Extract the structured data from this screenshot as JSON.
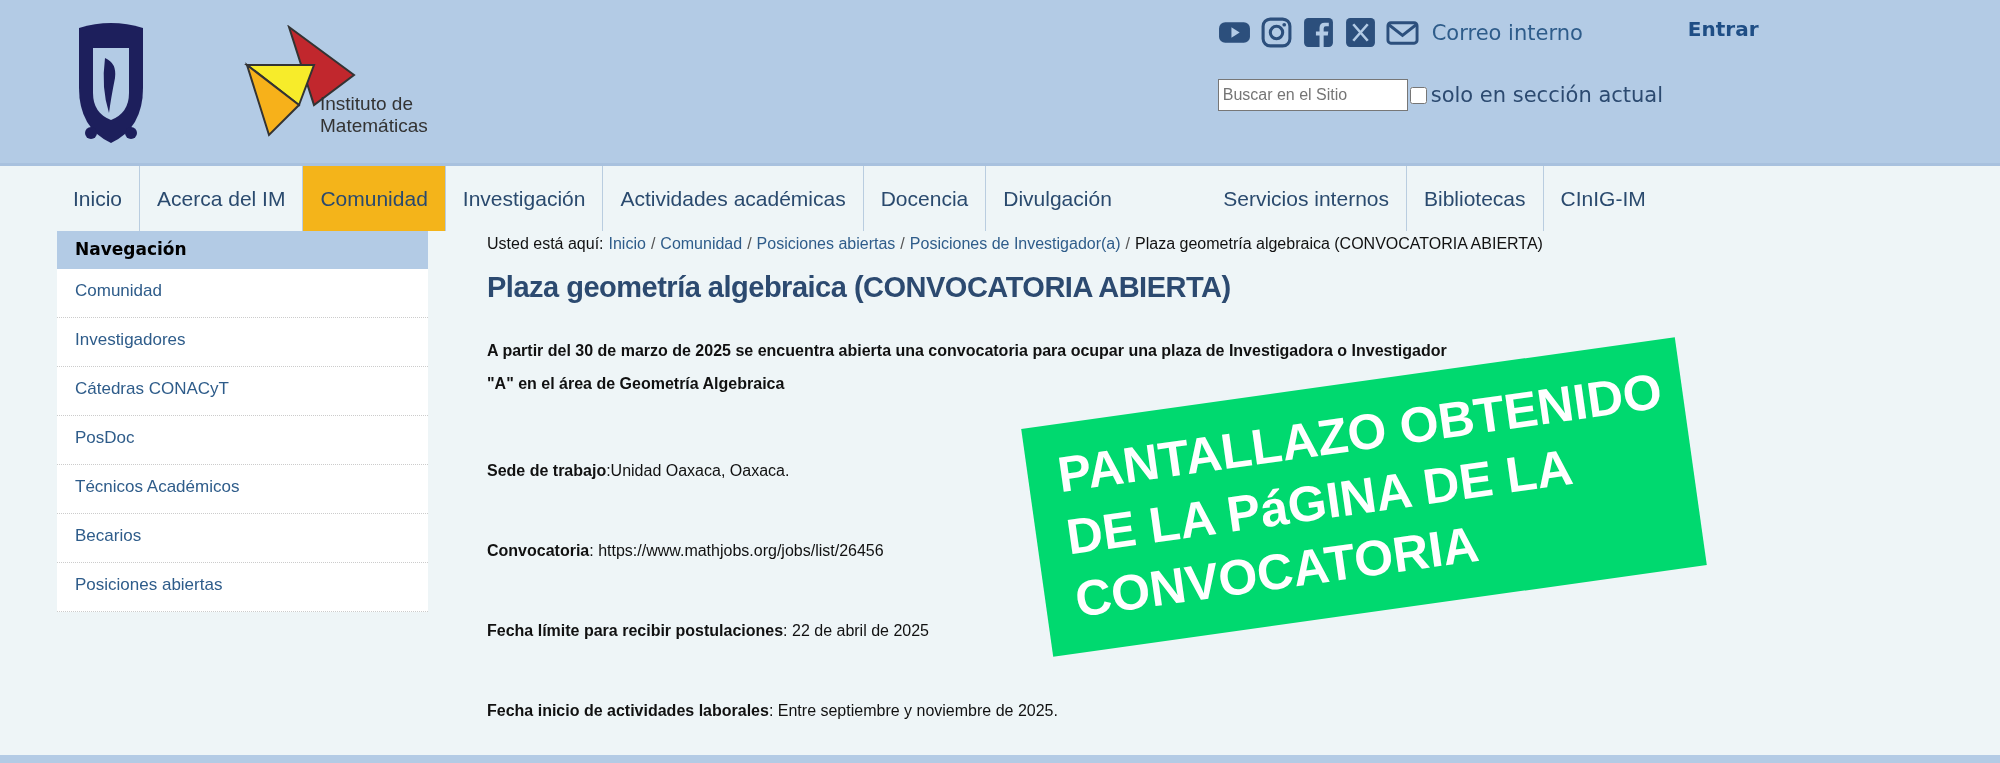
{
  "header": {
    "logo_text": [
      "Instituto de",
      "Matemáticas"
    ],
    "mail_link": "Correo interno",
    "login_link": "Entrar",
    "search": {
      "placeholder": "Buscar en el Sitio"
    },
    "scope_checkbox": {
      "label": "solo en sección actual",
      "checked": false
    }
  },
  "nav": [
    {
      "label": "Inicio",
      "selected": false
    },
    {
      "label": "Acerca del IM",
      "selected": false
    },
    {
      "label": "Comunidad",
      "selected": true
    },
    {
      "label": "Investigación",
      "selected": false
    },
    {
      "label": "Actividades académicas",
      "selected": false
    },
    {
      "label": "Docencia",
      "selected": false
    },
    {
      "label": "Divulgación",
      "selected": false
    },
    {
      "label": "Servicios internos",
      "selected": false
    },
    {
      "label": "Bibliotecas",
      "selected": false
    },
    {
      "label": "CInIG-IM",
      "selected": false
    }
  ],
  "sidebar": {
    "title": "Navegación",
    "items": [
      "Comunidad",
      "Investigadores",
      "Cátedras CONACyT",
      "PosDoc",
      "Técnicos Académicos",
      "Becarios",
      "Posiciones abiertas"
    ]
  },
  "breadcrumb": {
    "prefix": "Usted está aquí:",
    "links": [
      {
        "label": "Inicio",
        "separator": "/"
      },
      {
        "label": "Comunidad",
        "separator": "/"
      },
      {
        "label": "Posiciones abiertas",
        "separator": "/"
      },
      {
        "label": "Posiciones de Investigador(a)",
        "separator": "/"
      }
    ],
    "current": "Plaza geometría algebraica (CONVOCATORIA ABIERTA)"
  },
  "title": "Plaza geometría algebraica (CONVOCATORIA ABIERTA)",
  "intro_lines": [
    "A partir del 30 de marzo de 2025 se encuentra abierta una convocatoria para ocupar una plaza de Investigadora o Investigador",
    "\"A\" en el área de Geometría Algebraica"
  ],
  "fields": [
    "**Sede de trabajo**:Unidad Oaxaca, Oaxaca.",
    "**Convocatoria**: https://www.mathjobs.org/jobs/list/26456",
    "**Fecha límite para recibir postulaciones**: 22 de abril de 2025",
    "**Fecha inicio de actividades laborales**: Entre septiembre y noviembre de 2025."
  ],
  "overlay_banner": [
    "PANTALLAZO OBTENIDO",
    "DE LA PáGINA DE LA",
    "CONVOCATORIA"
  ]
}
